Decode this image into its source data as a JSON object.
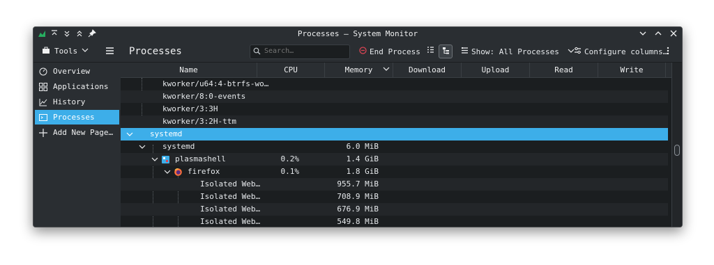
{
  "window": {
    "title": "Processes — System Monitor"
  },
  "toolbar": {
    "tools_label": "Tools",
    "page_title": "Processes",
    "search_placeholder": "Search…",
    "end_process_label": "End Process",
    "show_label": "Show: All Processes",
    "configure_label": "Configure columns…"
  },
  "sidebar": {
    "items": [
      {
        "label": "Overview",
        "icon": "gauge-icon"
      },
      {
        "label": "Applications",
        "icon": "grid-icon"
      },
      {
        "label": "History",
        "icon": "chart-icon"
      },
      {
        "label": "Processes",
        "icon": "terminal-icon",
        "active": true
      },
      {
        "label": "Add New Page…",
        "icon": "plus-icon"
      }
    ]
  },
  "table": {
    "columns": [
      "Name",
      "CPU",
      "Memory",
      "Download",
      "Upload",
      "Read",
      "Write"
    ],
    "rows": [
      {
        "name": "kworker/u64:4-btrfs-wo…",
        "cpu": "",
        "memory": ""
      },
      {
        "name": "kworker/8:0-events",
        "cpu": "",
        "memory": ""
      },
      {
        "name": "kworker/3:3H",
        "cpu": "",
        "memory": ""
      },
      {
        "name": "kworker/3:2H-ttm",
        "cpu": "",
        "memory": ""
      },
      {
        "name": "systemd",
        "cpu": "",
        "memory": ""
      },
      {
        "name": "systemd",
        "cpu": "",
        "memory": "6.0 MiB"
      },
      {
        "name": "plasmashell",
        "cpu": "0.2%",
        "memory": "1.4 GiB"
      },
      {
        "name": "firefox",
        "cpu": "0.1%",
        "memory": "1.8 GiB"
      },
      {
        "name": "Isolated Web…",
        "cpu": "",
        "memory": "955.7 MiB"
      },
      {
        "name": "Isolated Web…",
        "cpu": "",
        "memory": "708.9 MiB"
      },
      {
        "name": "Isolated Web…",
        "cpu": "",
        "memory": "676.9 MiB"
      },
      {
        "name": "Isolated Web…",
        "cpu": "",
        "memory": "549.8 MiB"
      }
    ]
  },
  "colors": {
    "accent": "#3daee9",
    "background": "#1b1e20",
    "panel": "#2a2e32"
  }
}
